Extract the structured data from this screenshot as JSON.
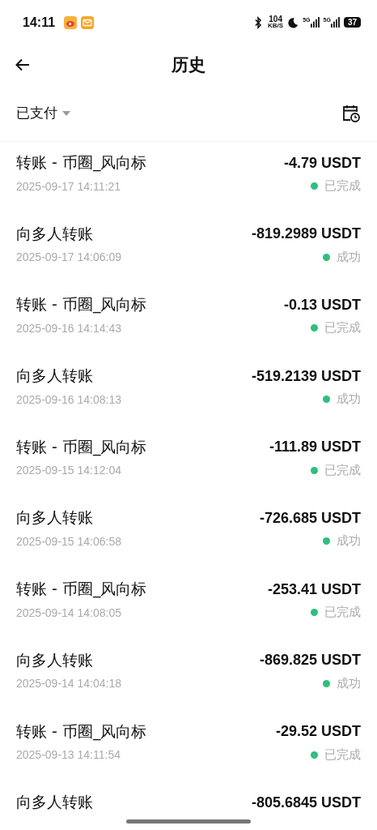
{
  "status_bar": {
    "time": "14:11",
    "speed": "104",
    "speed_unit": "KB/S",
    "network_1": "5G",
    "network_2": "5G",
    "battery": "37"
  },
  "header": {
    "title": "历史"
  },
  "filter": {
    "label": "已支付"
  },
  "transactions": [
    {
      "title": "转账 - 币圈_风向标",
      "date": "2025-09-17 14:11:21",
      "amount": "-4.79 USDT",
      "status": "已完成"
    },
    {
      "title": "向多人转账",
      "date": "2025-09-17 14:06:09",
      "amount": "-819.2989 USDT",
      "status": "成功"
    },
    {
      "title": "转账 - 币圈_风向标",
      "date": "2025-09-16 14:14:43",
      "amount": "-0.13 USDT",
      "status": "已完成"
    },
    {
      "title": "向多人转账",
      "date": "2025-09-16 14:08:13",
      "amount": "-519.2139 USDT",
      "status": "成功"
    },
    {
      "title": "转账 - 币圈_风向标",
      "date": "2025-09-15 14:12:04",
      "amount": "-111.89 USDT",
      "status": "已完成"
    },
    {
      "title": "向多人转账",
      "date": "2025-09-15 14:06:58",
      "amount": "-726.685 USDT",
      "status": "成功"
    },
    {
      "title": "转账 - 币圈_风向标",
      "date": "2025-09-14 14:08:05",
      "amount": "-253.41 USDT",
      "status": "已完成"
    },
    {
      "title": "向多人转账",
      "date": "2025-09-14 14:04:18",
      "amount": "-869.825 USDT",
      "status": "成功"
    },
    {
      "title": "转账 - 币圈_风向标",
      "date": "2025-09-13 14:11:54",
      "amount": "-29.52 USDT",
      "status": "已完成"
    },
    {
      "title": "向多人转账",
      "amount": "-805.6845 USDT"
    }
  ]
}
